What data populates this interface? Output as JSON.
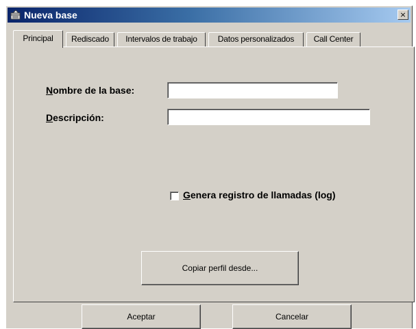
{
  "window": {
    "title": "Nueva base",
    "close_glyph": "×",
    "icon": "database-window-icon"
  },
  "tabs": [
    {
      "label": "Principal",
      "active": true
    },
    {
      "label": "Rediscado",
      "active": false
    },
    {
      "label": "Intervalos de trabajo",
      "active": false
    },
    {
      "label": "Datos personalizados",
      "active": false
    },
    {
      "label": "Call Center",
      "active": false
    }
  ],
  "form": {
    "name_label_mnemonic": "N",
    "name_label_rest": "ombre de la base:",
    "name_value": "",
    "description_label_mnemonic": "D",
    "description_label_rest": "escripción:",
    "description_value": "",
    "log_checkbox_mnemonic": "G",
    "log_checkbox_rest": "enera registro de llamadas (log)",
    "log_checked": false,
    "copy_profile_button": "Copiar perfil desde..."
  },
  "footer": {
    "accept_button": "Aceptar",
    "cancel_button": "Cancelar"
  },
  "colors": {
    "dialog_face": "#d4d0c8",
    "titlebar_start": "#0a246a",
    "titlebar_end": "#a6caf0"
  }
}
